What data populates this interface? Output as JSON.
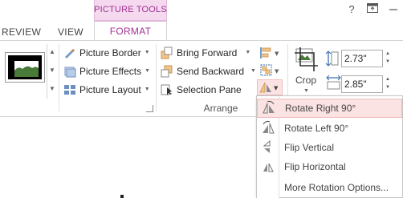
{
  "title_bar": {
    "contextual_group": "PICTURE TOOLS",
    "help": "?"
  },
  "tabs": {
    "review": "REVIEW",
    "view": "VIEW",
    "format": "FORMAT"
  },
  "adjust": {
    "picture_border": "Picture Border",
    "picture_effects": "Picture Effects",
    "picture_layout": "Picture Layout"
  },
  "arrange": {
    "bring_forward": "Bring Forward",
    "send_backward": "Send Backward",
    "selection_pane": "Selection Pane",
    "group_label": "Arrange"
  },
  "size": {
    "crop": "Crop",
    "height_value": "2.73\"",
    "width_value": "2.85\""
  },
  "rotate_menu": {
    "items": [
      {
        "label": "Rotate Right 90°",
        "icon": "rotate-right-icon",
        "highlighted": true
      },
      {
        "label": "Rotate Left 90°",
        "icon": "rotate-left-icon",
        "highlighted": false
      },
      {
        "label": "Flip Vertical",
        "icon": "flip-vertical-icon",
        "highlighted": false
      },
      {
        "label": "Flip Horizontal",
        "icon": "flip-horizontal-icon",
        "highlighted": false
      },
      {
        "label": "More Rotation Options...",
        "icon": "",
        "highlighted": false
      }
    ]
  },
  "colors": {
    "accent": "#a33194",
    "context_band": "#f4d9ef",
    "highlight": "#fbe3e3"
  }
}
